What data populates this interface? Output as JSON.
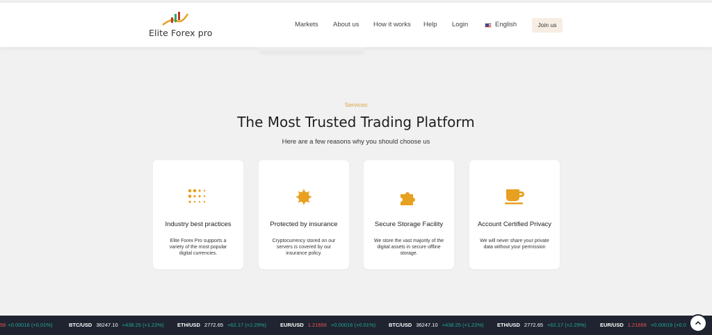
{
  "brand": {
    "name": "Elite Forex pro",
    "accent": "#e8a020"
  },
  "nav": {
    "items": [
      "Markets",
      "About us",
      "How it works",
      "Help",
      "Login"
    ],
    "language": "English",
    "join_label": "Join us"
  },
  "services": {
    "eyebrow": "Services",
    "headline": "The Most Trusted Trading Platform",
    "subhead": "Here are a few reasons why you should choose us",
    "cards": [
      {
        "icon": "dots-grid-icon",
        "title": "Industry best practices",
        "desc": "Elite Forex Pro supports a variety of the most popular digital currencies."
      },
      {
        "icon": "sun-badge-icon",
        "title": "Protected by insurance",
        "desc": "Cryptocurrency stored on our servers is covered by our insurance policy."
      },
      {
        "icon": "puzzle-icon",
        "title": "Secure Storage Facility",
        "desc": "We store the vast majority of the digital assets in secure offline storage."
      },
      {
        "icon": "coffee-cup-icon",
        "title": "Account Certified Privacy",
        "desc": "We will never share your private data without your permission"
      }
    ]
  },
  "ticker": {
    "items": [
      {
        "symbol": "",
        "price": "",
        "change": "+0.00016 (+0.01%)",
        "price_color": "red",
        "leading_fragment": "56"
      },
      {
        "symbol": "BTC/USD",
        "price": "36247.10",
        "change": "+438.25 (+1.22%)",
        "price_color": "white"
      },
      {
        "symbol": "ETH/USD",
        "price": "2772.65",
        "change": "+62.17 (+2.29%)",
        "price_color": "white"
      },
      {
        "symbol": "EUR/USD",
        "price": "1.21656",
        "change": "+0.00016 (+0.01%)",
        "price_color": "red"
      },
      {
        "symbol": "BTC/USD",
        "price": "36247.10",
        "change": "+438.25 (+1.22%)",
        "price_color": "white"
      },
      {
        "symbol": "ETH/USD",
        "price": "2772.65",
        "change": "+62.17 (+2.29%)",
        "price_color": "white"
      },
      {
        "symbol": "EUR/USD",
        "price": "1.21656",
        "change": "+0.00016 (+0.0",
        "price_color": "red"
      }
    ]
  }
}
